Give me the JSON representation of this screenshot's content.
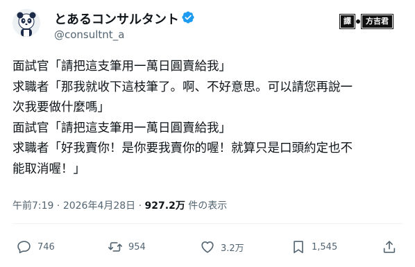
{
  "tweet": {
    "author": {
      "display_name": "とあるコンサルタント",
      "handle": "@consultnt_a",
      "avatar_icon": "panda-avatar-icon",
      "verified_icon": "verified-badge-icon",
      "verified_color": "#1d9bf0"
    },
    "watermark": {
      "left": "譯",
      "right": "方吉君"
    },
    "body_lines": [
      "面試官「請把這支筆用一萬日圓賣給我」",
      "求職者「那我就收下這枝筆了。啊、不好意思。可以請您再說一",
      "次我要做什麼嗎」",
      "面試官「請把這支筆用一萬日圓賣給我」",
      "求職者「好我賣你！是你要我賣你的喔！就算只是口頭約定也不",
      "能取消喔！」"
    ],
    "meta": {
      "time": "午前7:19",
      "separator": "·",
      "date": "2026年4月28日",
      "views_count": "927.2万",
      "views_label": "件の表示"
    },
    "actions": {
      "replies": {
        "icon": "reply-icon",
        "count": "746"
      },
      "reposts": {
        "icon": "repost-icon",
        "count": "954"
      },
      "likes": {
        "icon": "like-icon",
        "count": "3.2万"
      },
      "bookmarks": {
        "icon": "bookmark-icon",
        "count": "1,545"
      },
      "share": {
        "icon": "share-icon"
      }
    }
  }
}
